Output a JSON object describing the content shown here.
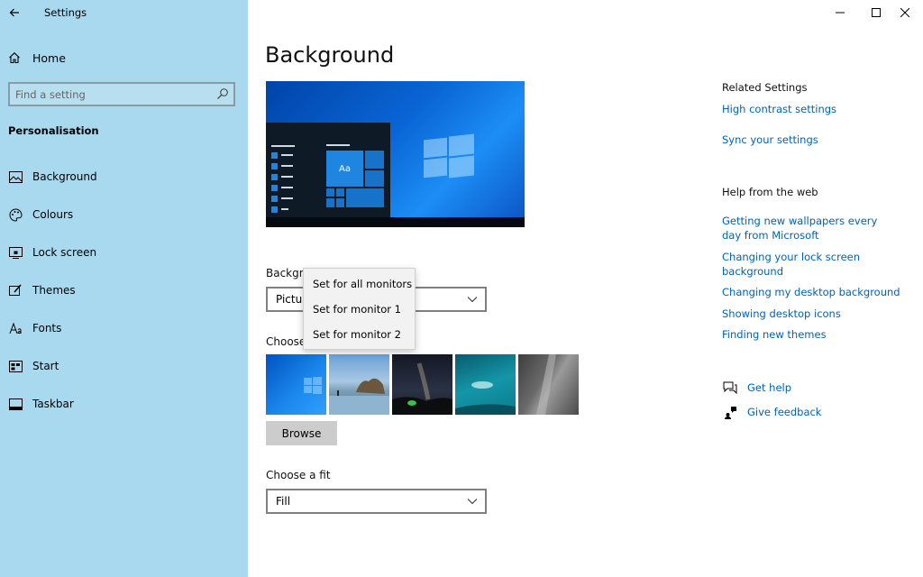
{
  "app": {
    "title": "Settings"
  },
  "sidebar": {
    "home_label": "Home",
    "search_placeholder": "Find a setting",
    "section": "Personalisation",
    "items": [
      {
        "label": "Background",
        "icon": "picture-icon"
      },
      {
        "label": "Colours",
        "icon": "palette-icon"
      },
      {
        "label": "Lock screen",
        "icon": "lock-screen-icon"
      },
      {
        "label": "Themes",
        "icon": "brush-icon"
      },
      {
        "label": "Fonts",
        "icon": "font-icon"
      },
      {
        "label": "Start",
        "icon": "start-icon"
      },
      {
        "label": "Taskbar",
        "icon": "taskbar-icon"
      }
    ]
  },
  "main": {
    "title": "Background",
    "background_label": "Backgro",
    "background_value": "Pictur",
    "choose_label": "Choose",
    "browse_label": "Browse",
    "fit_label": "Choose a fit",
    "fit_value": "Fill"
  },
  "context_menu": {
    "items": [
      "Set for all monitors",
      "Set for monitor 1",
      "Set for monitor 2"
    ]
  },
  "related": {
    "heading": "Related Settings",
    "links": [
      "High contrast settings",
      "Sync your settings"
    ]
  },
  "help_web": {
    "heading": "Help from the web",
    "links": [
      "Getting new wallpapers every day from Microsoft",
      "Changing your lock screen background",
      "Changing my desktop background",
      "Showing desktop icons",
      "Finding new themes"
    ]
  },
  "support": {
    "get_help": "Get help",
    "give_feedback": "Give feedback"
  },
  "preview": {
    "tile_label": "Aa"
  },
  "colors": {
    "sidebar_bg": "#a9d9ee",
    "link": "#0063b1",
    "accent": "#0078d7"
  }
}
